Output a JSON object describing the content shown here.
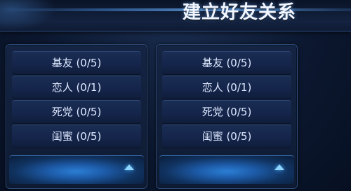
{
  "header": {
    "title": "建立好友关系"
  },
  "panels": [
    {
      "items": [
        {
          "label": "基友 (0/5)"
        },
        {
          "label": "恋人 (0/1)"
        },
        {
          "label": "死党 (0/5)"
        },
        {
          "label": "闺蜜 (0/5)"
        }
      ],
      "expand_icon": "chevron-up-icon"
    },
    {
      "items": [
        {
          "label": "基友 (0/5)"
        },
        {
          "label": "恋人 (0/1)"
        },
        {
          "label": "死党 (0/5)"
        },
        {
          "label": "闺蜜 (0/5)"
        }
      ],
      "expand_icon": "chevron-up-icon"
    }
  ],
  "colors": {
    "background": "#0c1830",
    "accent": "#2b7fd6",
    "text": "#dfe9ff",
    "title": "#f2f6ff"
  }
}
